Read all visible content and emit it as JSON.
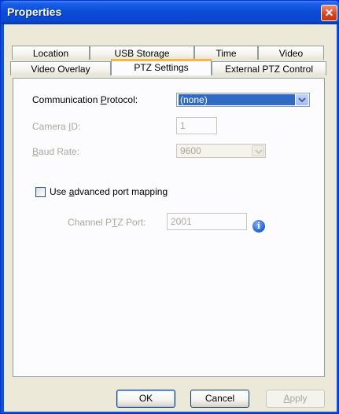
{
  "window": {
    "title": "Properties",
    "close_glyph": "✕"
  },
  "tabs": {
    "row1": [
      "Location",
      "USB Storage",
      "Time",
      "Video"
    ],
    "row2": [
      "Video Overlay",
      "PTZ Settings",
      "External PTZ Control"
    ],
    "active": "PTZ Settings"
  },
  "form": {
    "protocol_label_pre": "Communication ",
    "protocol_label_key": "P",
    "protocol_label_post": "rotocol:",
    "protocol_value": "(none)",
    "camera_id_label_pre": "Camera ",
    "camera_id_label_key": "I",
    "camera_id_label_post": "D:",
    "camera_id_value": "1",
    "baud_label_key": "B",
    "baud_label_post": "aud Rate:",
    "baud_value": "9600",
    "advanced_label_pre": "Use ",
    "advanced_label_key": "a",
    "advanced_label_post": "dvanced port mapping",
    "advanced_checked": false,
    "channel_label_pre": "Channel P",
    "channel_label_key": "T",
    "channel_label_post": "Z Port:",
    "channel_value": "2001",
    "info_glyph": "i"
  },
  "buttons": {
    "ok": "OK",
    "cancel": "Cancel",
    "apply_key": "A",
    "apply_post": "pply"
  },
  "colors": {
    "title_bar": "#0a4ad6",
    "dialog_bg": "#ece9d8",
    "active_tab_accent": "#f7b64a",
    "selection": "#316ac5"
  }
}
